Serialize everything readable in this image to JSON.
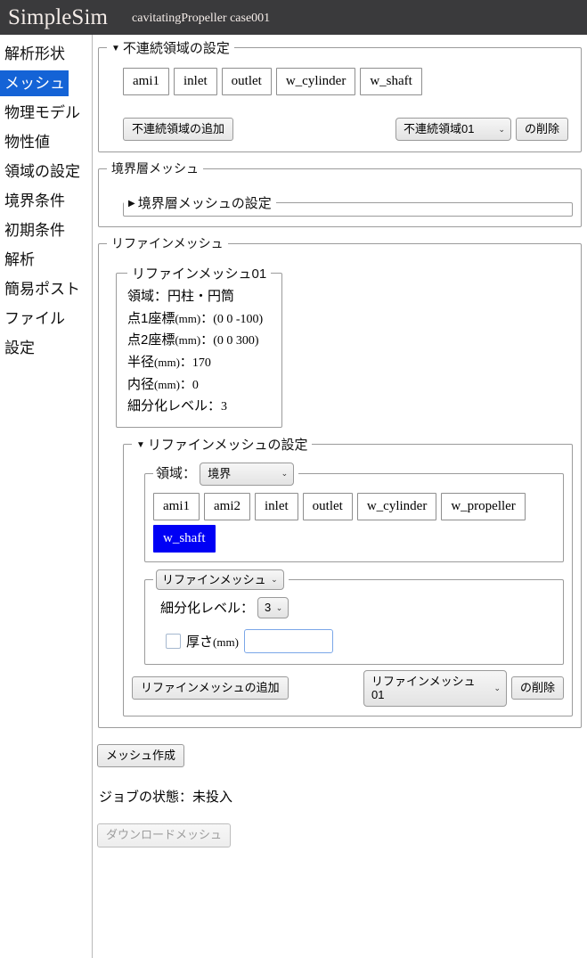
{
  "header": {
    "brand": "SimpleSim",
    "case_title": "cavitatingPropeller case001"
  },
  "sidebar": {
    "items": [
      {
        "label": "解析形状",
        "active": false
      },
      {
        "label": "メッシュ",
        "active": true
      },
      {
        "label": "物理モデル",
        "active": false
      },
      {
        "label": "物性値",
        "active": false
      },
      {
        "label": "領域の設定",
        "active": false
      },
      {
        "label": "境界条件",
        "active": false
      },
      {
        "label": "初期条件",
        "active": false
      },
      {
        "label": "解析",
        "active": false
      },
      {
        "label": "簡易ポスト",
        "active": false
      },
      {
        "label": "ファイル",
        "active": false
      },
      {
        "label": "設定",
        "active": false
      }
    ]
  },
  "discontinuous": {
    "legend": "不連続領域の設定",
    "triangle": "▼",
    "chips": [
      "ami1",
      "inlet",
      "outlet",
      "w_cylinder",
      "w_shaft"
    ],
    "add_label": "不連続領域の追加",
    "select_value": "不連続領域01",
    "delete_label": "の削除"
  },
  "boundary_layer": {
    "legend": "境界層メッシュ",
    "inner_legend": "境界層メッシュの設定",
    "triangle": "▶"
  },
  "refine": {
    "legend": "リファインメッシュ",
    "info": {
      "legend": "リファインメッシュ01",
      "region_label": "領域：円柱・円筒",
      "point1_label": "点1座標",
      "point1_unit": "(mm)",
      "point1_value": "：(0 0 -100)",
      "point2_label": "点2座標",
      "point2_unit": "(mm)",
      "point2_value": "：(0 0 300)",
      "radius_label": "半径",
      "radius_unit": "(mm)",
      "radius_value": "：170",
      "inner_label": "内径",
      "inner_unit": "(mm)",
      "inner_value": "：0",
      "level_label": "細分化レベル：",
      "level_value": "3"
    },
    "settings": {
      "legend": "リファインメッシュの設定",
      "triangle": "▼",
      "region_legend_label": "領域：",
      "region_select_value": "境界",
      "chips": [
        "ami1",
        "ami2",
        "inlet",
        "outlet",
        "w_cylinder",
        "w_propeller",
        "w_shaft"
      ],
      "selected_chip": "w_shaft",
      "type_select_value": "リファインメッシュ",
      "level_label": "細分化レベル：",
      "level_value": "3",
      "thickness_label": "厚さ",
      "thickness_unit": "(mm)",
      "thickness_value": ""
    },
    "add_label": "リファインメッシュの追加",
    "select_value": "リファインメッシュ01",
    "delete_label": "の削除"
  },
  "footer": {
    "create_mesh_label": "メッシュ作成",
    "job_status": "ジョブの状態：未投入",
    "download_label": "ダウンロードメッシュ"
  },
  "icons": {
    "caret": "⌄"
  }
}
